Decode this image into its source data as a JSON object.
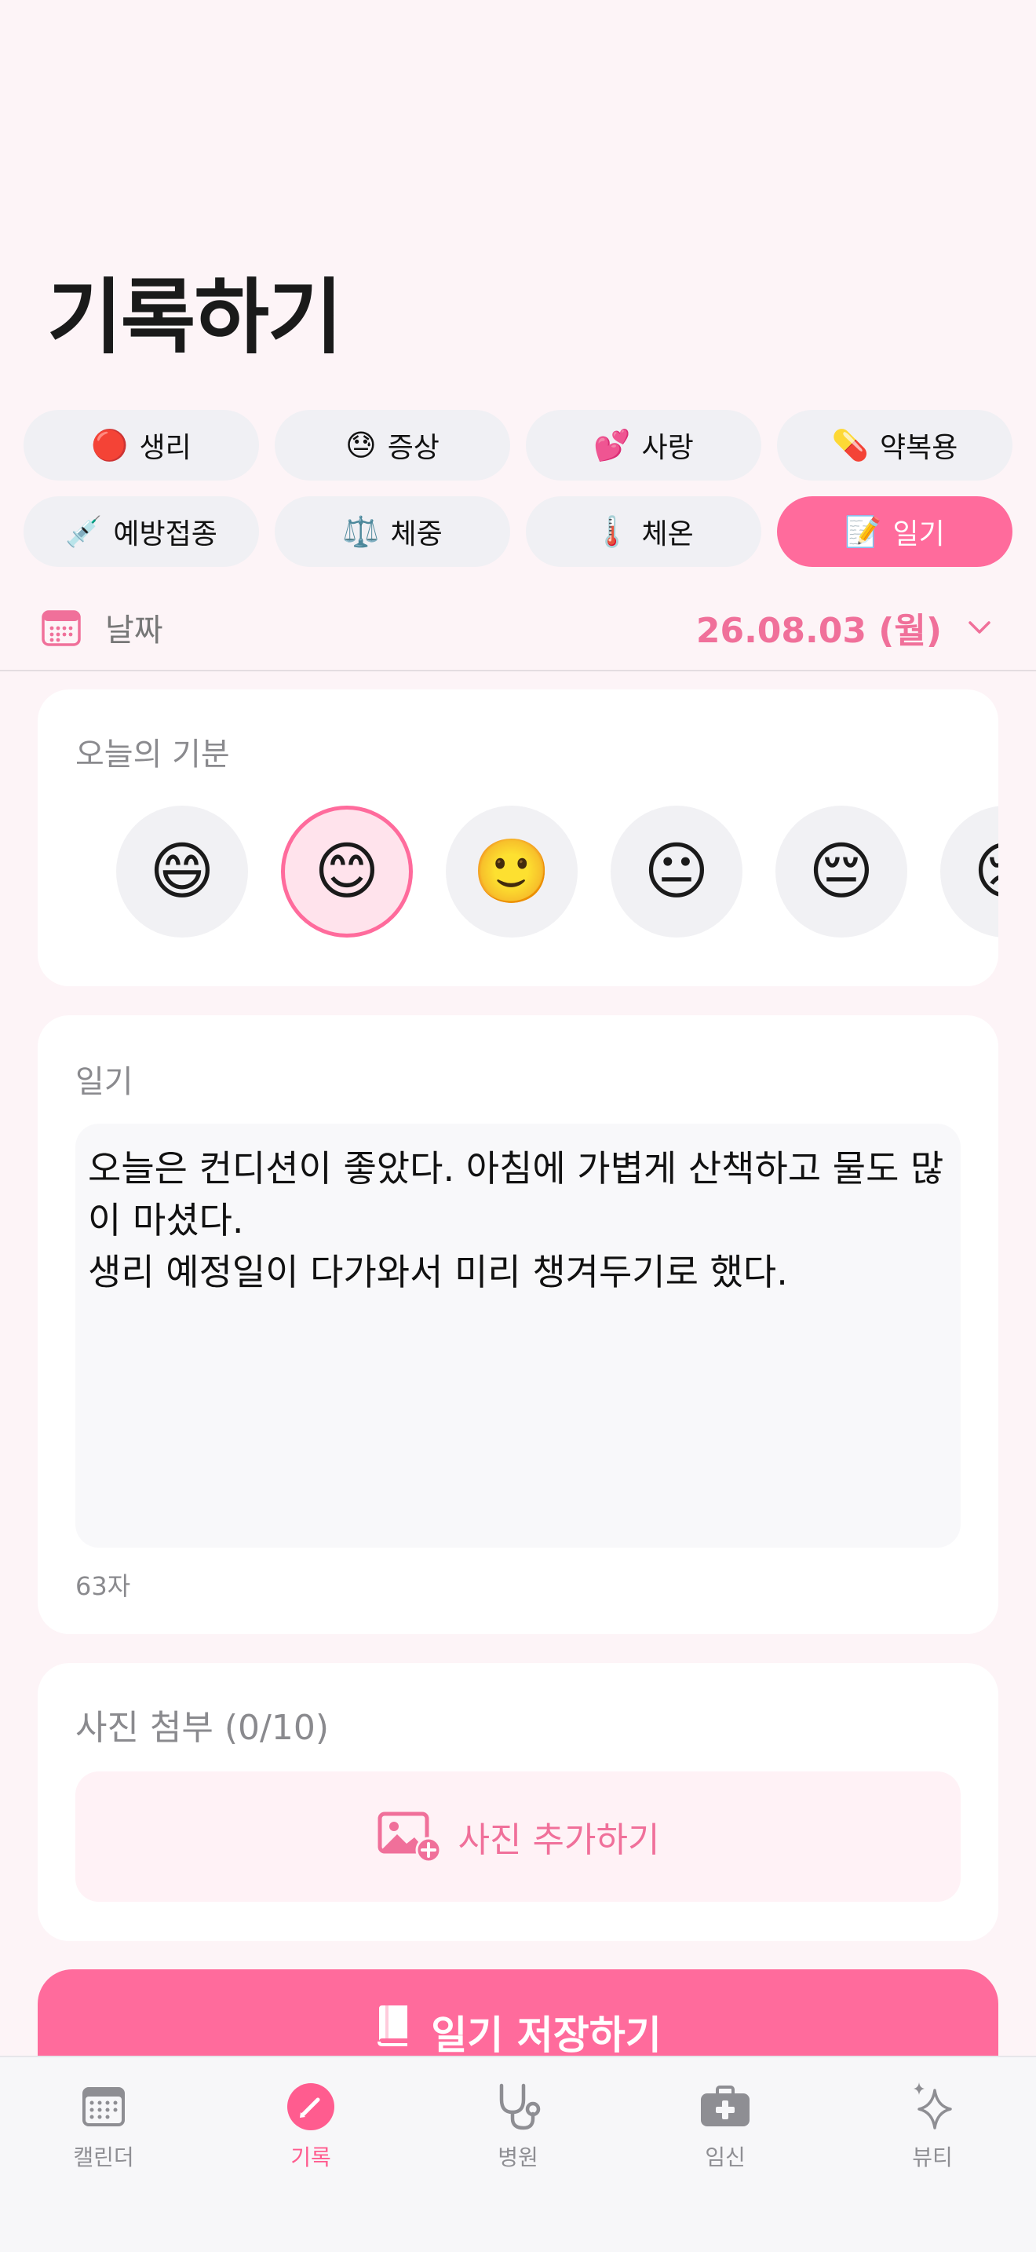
{
  "page": {
    "title": "기록하기"
  },
  "categories": [
    {
      "emoji": "🔴",
      "label": "생리"
    },
    {
      "emoji": "😓",
      "label": "증상"
    },
    {
      "emoji": "💕",
      "label": "사랑"
    },
    {
      "emoji": "💊",
      "label": "약복용"
    },
    {
      "emoji": "💉",
      "label": "예방접종"
    },
    {
      "emoji": "⚖️",
      "label": "체중"
    },
    {
      "emoji": "🌡️",
      "label": "체온"
    },
    {
      "emoji": "📝",
      "label": "일기"
    }
  ],
  "selected_category": "일기",
  "date": {
    "label": "날짜",
    "value": "26.08.03 (월)"
  },
  "mood": {
    "label": "오늘의 기분",
    "options": [
      "😄",
      "😊",
      "🙂",
      "😐",
      "😔",
      "😢"
    ],
    "selected_index": 1
  },
  "diary": {
    "label": "일기",
    "text": "오늘은 컨디션이 좋았다. 아침에 가볍게 산책하고 물도 많이 마셨다.\n생리 예정일이 다가와서 미리 챙겨두기로 했다.",
    "counter": "63자"
  },
  "photos": {
    "label": "사진 첨부 (0/10)",
    "add_label": "사진 추가하기"
  },
  "save_button": {
    "label": "일기 저장하기"
  },
  "tabs": [
    {
      "label": "캘린더",
      "icon": "calendar-icon"
    },
    {
      "label": "기록",
      "icon": "pencil-icon"
    },
    {
      "label": "병원",
      "icon": "stethoscope-icon"
    },
    {
      "label": "임신",
      "icon": "medical-kit-icon"
    },
    {
      "label": "뷰티",
      "icon": "sparkle-icon"
    }
  ],
  "active_tab": "기록",
  "colors": {
    "accent": "#ff6b9c",
    "accent_text": "#f0709a",
    "background": "#fdf4f7"
  }
}
